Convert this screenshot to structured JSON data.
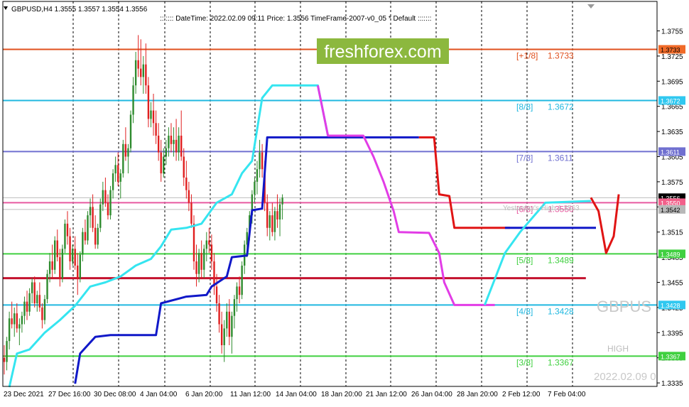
{
  "header": {
    "symbol_text": "GBPUSD,H4  1.3555 1.3557 1.3554 1.3556",
    "info_text": "::::::: DateTime: 2022.02.09 09:11    Price: 1.3556    TimeFrame-2007-v0_05    *  Default  :::::::"
  },
  "brand": {
    "text": "freshforex.com"
  },
  "watermark": {
    "symbol": "GBPUS",
    "high_label": "HIGH",
    "time_label": "2022.02.09 0"
  },
  "ghost": {
    "yesterday_label": "Yesterday's High 1.3563"
  },
  "colors": {
    "bull": "#2e8b2e",
    "bear": "#e01f1f",
    "bg": "#ffffff",
    "cyan": "#35e5f0",
    "magenta": "#e23ce6",
    "blue": "#1018c8",
    "red": "#e01414",
    "crimson": "#c4122e"
  },
  "chart_data": {
    "type": "candlestick",
    "symbol": "GBPUSD",
    "timeframe": "H4",
    "ylim": [
      1.333,
      1.378
    ],
    "y_ticks": [
      "1.3755",
      "1.3725",
      "1.3695",
      "1.3665",
      "1.3635",
      "1.3605",
      "1.3575",
      "1.3545",
      "1.3515",
      "1.3485",
      "1.3455",
      "1.3425",
      "1.3395",
      "1.3365",
      "1.3335"
    ],
    "x_ticks": [
      "23 Dec 2021",
      "27 Dec 16:00",
      "30 Dec 08:00",
      "4 Jan 04:00",
      "6 Jan 20:00",
      "11 Jan 12:00",
      "14 Jan 04:00",
      "18 Jan 20:00",
      "21 Jan 12:00",
      "26 Jan 04:00",
      "28 Jan 20:00",
      "2 Feb 12:00",
      "7 Feb 04:00"
    ],
    "current_price": "1.3556",
    "murrey_levels": [
      {
        "label": "[+1/8]",
        "value": "1.3733",
        "color": "#e0501e"
      },
      {
        "label": "[8/8]",
        "value": "1.3672",
        "color": "#20b8e0"
      },
      {
        "label": "[7/8]",
        "value": "1.3611",
        "color": "#7070d0"
      },
      {
        "label": "[6/8]",
        "value": "1.3550",
        "color": "#e85aa0"
      },
      {
        "label": "[5/8]",
        "value": "1.3489",
        "color": "#40d040"
      },
      {
        "label": "[4/8]",
        "value": "1.3428",
        "color": "#20b8e0"
      },
      {
        "label": "[3/8]",
        "value": "1.3367",
        "color": "#40d040"
      }
    ],
    "axis_tags": [
      {
        "value": "1.3733",
        "bg": "#f06a28",
        "fg": "#000000"
      },
      {
        "value": "1.3672",
        "bg": "#30c8f0",
        "fg": "#ffffff"
      },
      {
        "value": "1.3611",
        "bg": "#7070d0",
        "fg": "#ffffff"
      },
      {
        "value": "1.3556",
        "bg": "#000000",
        "fg": "#ffffff"
      },
      {
        "value": "1.3550",
        "bg": "#f2608a",
        "fg": "#ffffff"
      },
      {
        "value": "1.3542",
        "bg": "#b8b8b8",
        "fg": "#000000"
      },
      {
        "value": "1.3489",
        "bg": "#40d040",
        "fg": "#ffffff"
      },
      {
        "value": "1.3428",
        "bg": "#30c8f0",
        "fg": "#ffffff"
      },
      {
        "value": "1.3367",
        "bg": "#40d040",
        "fg": "#ffffff"
      }
    ],
    "horizontal_lines": [
      {
        "value": 1.3542,
        "color": "#bdbdbd"
      },
      {
        "value": 1.3556,
        "color": "#bdbdbd"
      },
      {
        "value": 1.346,
        "color": "#c4122e",
        "to_bar": 230
      }
    ],
    "cyan_line": [
      [
        2,
        1.333
      ],
      [
        5,
        1.337
      ],
      [
        10,
        1.3375
      ],
      [
        16,
        1.3395
      ],
      [
        22,
        1.341
      ],
      [
        28,
        1.3427
      ],
      [
        34,
        1.345
      ],
      [
        40,
        1.3455
      ],
      [
        46,
        1.3462
      ],
      [
        52,
        1.3475
      ],
      [
        58,
        1.3483
      ],
      [
        62,
        1.3498
      ],
      [
        66,
        1.3518
      ],
      [
        72,
        1.352
      ],
      [
        78,
        1.3525
      ],
      [
        84,
        1.355
      ],
      [
        90,
        1.356
      ],
      [
        94,
        1.3585
      ],
      [
        98,
        1.36
      ],
      [
        102,
        1.3675
      ],
      [
        106,
        1.369
      ],
      [
        124,
        1.369
      ],
      [
        128,
        1.363
      ],
      [
        140,
        1.363
      ],
      [
        142,
        1.363
      ]
    ],
    "magenta_line": [
      [
        124,
        1.369
      ],
      [
        128,
        1.363
      ],
      [
        142,
        1.363
      ],
      [
        146,
        1.3605
      ],
      [
        150,
        1.3575
      ],
      [
        154,
        1.354
      ],
      [
        156,
        1.3515
      ],
      [
        168,
        1.3514
      ],
      [
        172,
        1.349
      ],
      [
        174,
        1.3455
      ],
      [
        178,
        1.3428
      ],
      [
        194,
        1.3428
      ]
    ],
    "cyan_line2": [
      [
        190,
        1.3428
      ],
      [
        198,
        1.349
      ],
      [
        204,
        1.3515
      ],
      [
        214,
        1.355
      ],
      [
        232,
        1.3552
      ]
    ],
    "blue_line": [
      [
        28,
        1.3334
      ],
      [
        30,
        1.337
      ],
      [
        36,
        1.339
      ],
      [
        42,
        1.3392
      ],
      [
        60,
        1.3392
      ],
      [
        62,
        1.343
      ],
      [
        72,
        1.3438
      ],
      [
        80,
        1.344
      ],
      [
        82,
        1.345
      ],
      [
        88,
        1.3462
      ],
      [
        90,
        1.3485
      ],
      [
        96,
        1.3487
      ],
      [
        98,
        1.3541
      ],
      [
        102,
        1.3543
      ],
      [
        104,
        1.3628
      ],
      [
        164,
        1.3628
      ]
    ],
    "red_line": [
      [
        164,
        1.3628
      ],
      [
        170,
        1.3628
      ],
      [
        172,
        1.356
      ],
      [
        176,
        1.3558
      ],
      [
        178,
        1.352
      ],
      [
        200,
        1.352
      ]
    ],
    "blue_line2": [
      [
        198,
        1.352
      ],
      [
        234,
        1.352
      ]
    ],
    "forecast_path": [
      [
        232,
        1.3556
      ],
      [
        235,
        1.354
      ],
      [
        238,
        1.349
      ],
      [
        241,
        1.351
      ],
      [
        243,
        1.356
      ]
    ],
    "candles": [
      [
        1.3365,
        1.338,
        1.3345,
        1.336
      ],
      [
        1.336,
        1.339,
        1.335,
        1.3385
      ],
      [
        1.3385,
        1.342,
        1.3375,
        1.3412
      ],
      [
        1.3412,
        1.3432,
        1.34,
        1.3405
      ],
      [
        1.3405,
        1.3425,
        1.339,
        1.3418
      ],
      [
        1.3418,
        1.343,
        1.3395,
        1.34
      ],
      [
        1.34,
        1.3412,
        1.338,
        1.3405
      ],
      [
        1.3405,
        1.342,
        1.3395,
        1.3415
      ],
      [
        1.3415,
        1.3438,
        1.3405,
        1.3432
      ],
      [
        1.3432,
        1.3445,
        1.341,
        1.342
      ],
      [
        1.342,
        1.3448,
        1.3415,
        1.3442
      ],
      [
        1.3442,
        1.346,
        1.343,
        1.3455
      ],
      [
        1.3455,
        1.3462,
        1.3425,
        1.343
      ],
      [
        1.343,
        1.3445,
        1.342,
        1.344
      ],
      [
        1.344,
        1.3455,
        1.342,
        1.3425
      ],
      [
        1.3425,
        1.343,
        1.34,
        1.341
      ],
      [
        1.341,
        1.344,
        1.3405,
        1.3435
      ],
      [
        1.3435,
        1.347,
        1.343,
        1.3465
      ],
      [
        1.3465,
        1.349,
        1.3455,
        1.348
      ],
      [
        1.348,
        1.35,
        1.346,
        1.347
      ],
      [
        1.347,
        1.351,
        1.3465,
        1.3505
      ],
      [
        1.3505,
        1.3518,
        1.348,
        1.3485
      ],
      [
        1.3485,
        1.3495,
        1.345,
        1.346
      ],
      [
        1.346,
        1.35,
        1.3455,
        1.3495
      ],
      [
        1.3495,
        1.353,
        1.349,
        1.3525
      ],
      [
        1.3525,
        1.354,
        1.35,
        1.351
      ],
      [
        1.351,
        1.352,
        1.347,
        1.348
      ],
      [
        1.348,
        1.35,
        1.3475,
        1.3495
      ],
      [
        1.3495,
        1.351,
        1.347,
        1.3475
      ],
      [
        1.3475,
        1.349,
        1.344,
        1.346
      ],
      [
        1.346,
        1.3492,
        1.3455,
        1.3488
      ],
      [
        1.3488,
        1.352,
        1.348,
        1.3515
      ],
      [
        1.3515,
        1.353,
        1.35,
        1.3505
      ],
      [
        1.3505,
        1.354,
        1.35,
        1.3535
      ],
      [
        1.3535,
        1.3555,
        1.352,
        1.3545
      ],
      [
        1.3545,
        1.356,
        1.3515,
        1.352
      ],
      [
        1.352,
        1.3535,
        1.3495,
        1.35
      ],
      [
        1.35,
        1.3525,
        1.3495,
        1.352
      ],
      [
        1.352,
        1.3555,
        1.3515,
        1.3548
      ],
      [
        1.3548,
        1.3575,
        1.354,
        1.3565
      ],
      [
        1.3565,
        1.358,
        1.3545,
        1.355
      ],
      [
        1.355,
        1.356,
        1.353,
        1.3535
      ],
      [
        1.3535,
        1.357,
        1.353,
        1.3565
      ],
      [
        1.3565,
        1.359,
        1.3555,
        1.3585
      ],
      [
        1.3585,
        1.3605,
        1.3575,
        1.3595
      ],
      [
        1.3595,
        1.361,
        1.357,
        1.3575
      ],
      [
        1.3575,
        1.359,
        1.3555,
        1.3585
      ],
      [
        1.3585,
        1.3625,
        1.358,
        1.362
      ],
      [
        1.362,
        1.364,
        1.36,
        1.3605
      ],
      [
        1.3605,
        1.362,
        1.3585,
        1.3615
      ],
      [
        1.3615,
        1.366,
        1.361,
        1.3655
      ],
      [
        1.3655,
        1.37,
        1.3645,
        1.369
      ],
      [
        1.369,
        1.373,
        1.368,
        1.372
      ],
      [
        1.372,
        1.375,
        1.37,
        1.371
      ],
      [
        1.371,
        1.3745,
        1.369,
        1.37
      ],
      [
        1.37,
        1.3725,
        1.368,
        1.3715
      ],
      [
        1.3715,
        1.374,
        1.368,
        1.369
      ],
      [
        1.369,
        1.37,
        1.364,
        1.365
      ],
      [
        1.365,
        1.367,
        1.364,
        1.366
      ],
      [
        1.366,
        1.368,
        1.363,
        1.3645
      ],
      [
        1.3645,
        1.366,
        1.362,
        1.363
      ],
      [
        1.363,
        1.3645,
        1.36,
        1.361
      ],
      [
        1.361,
        1.3625,
        1.3575,
        1.3585
      ],
      [
        1.3585,
        1.3615,
        1.358,
        1.3605
      ],
      [
        1.3605,
        1.3625,
        1.3595,
        1.3615
      ],
      [
        1.3615,
        1.364,
        1.3605,
        1.363
      ],
      [
        1.363,
        1.3645,
        1.361,
        1.362
      ],
      [
        1.362,
        1.364,
        1.3605,
        1.3625
      ],
      [
        1.3625,
        1.365,
        1.36,
        1.361
      ],
      [
        1.361,
        1.364,
        1.36,
        1.363
      ],
      [
        1.363,
        1.366,
        1.36,
        1.3605
      ],
      [
        1.3605,
        1.3615,
        1.357,
        1.358
      ],
      [
        1.358,
        1.36,
        1.3555,
        1.3565
      ],
      [
        1.3565,
        1.3575,
        1.354,
        1.355
      ],
      [
        1.355,
        1.356,
        1.352,
        1.3525
      ],
      [
        1.3525,
        1.3535,
        1.347,
        1.348
      ],
      [
        1.348,
        1.35,
        1.345,
        1.3465
      ],
      [
        1.3465,
        1.3495,
        1.3455,
        1.349
      ],
      [
        1.349,
        1.3505,
        1.346,
        1.347
      ],
      [
        1.347,
        1.35,
        1.346,
        1.3495
      ],
      [
        1.3495,
        1.3515,
        1.348,
        1.3505
      ],
      [
        1.3505,
        1.352,
        1.349,
        1.35
      ],
      [
        1.35,
        1.3512,
        1.347,
        1.348
      ],
      [
        1.348,
        1.349,
        1.344,
        1.345
      ],
      [
        1.345,
        1.3465,
        1.342,
        1.343
      ],
      [
        1.343,
        1.344,
        1.3395,
        1.3405
      ],
      [
        1.3405,
        1.342,
        1.337,
        1.338
      ],
      [
        1.338,
        1.341,
        1.336,
        1.34
      ],
      [
        1.34,
        1.343,
        1.339,
        1.342
      ],
      [
        1.342,
        1.3435,
        1.338,
        1.339
      ],
      [
        1.339,
        1.342,
        1.337,
        1.3415
      ],
      [
        1.3415,
        1.344,
        1.34,
        1.3435
      ],
      [
        1.3435,
        1.3455,
        1.342,
        1.345
      ],
      [
        1.345,
        1.3462,
        1.343,
        1.344
      ],
      [
        1.344,
        1.348,
        1.3435,
        1.3475
      ],
      [
        1.3475,
        1.3505,
        1.3465,
        1.35
      ],
      [
        1.35,
        1.352,
        1.3485,
        1.3515
      ],
      [
        1.3515,
        1.354,
        1.3505,
        1.3535
      ],
      [
        1.3535,
        1.3565,
        1.3525,
        1.356
      ],
      [
        1.356,
        1.358,
        1.355,
        1.3575
      ],
      [
        1.3575,
        1.36,
        1.356,
        1.359
      ],
      [
        1.359,
        1.3625,
        1.358,
        1.361
      ],
      [
        1.361,
        1.362,
        1.358,
        1.359
      ],
      [
        1.359,
        1.36,
        1.354,
        1.355
      ],
      [
        1.355,
        1.356,
        1.351,
        1.352
      ],
      [
        1.352,
        1.354,
        1.3505,
        1.3535
      ],
      [
        1.3535,
        1.355,
        1.351,
        1.3515
      ],
      [
        1.3515,
        1.3545,
        1.3505,
        1.354
      ],
      [
        1.354,
        1.356,
        1.352,
        1.353
      ],
      [
        1.353,
        1.3555,
        1.351,
        1.3548
      ],
      [
        1.3548,
        1.356,
        1.353,
        1.3556
      ]
    ]
  }
}
